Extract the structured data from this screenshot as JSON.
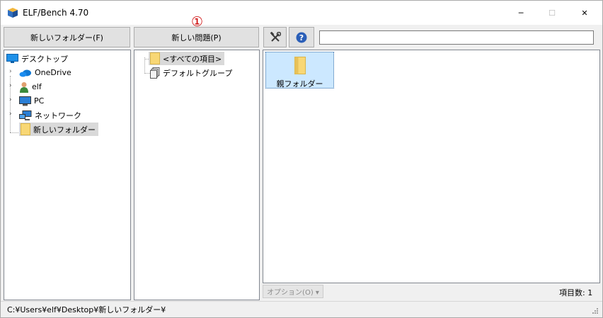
{
  "window": {
    "title": "ELF/Bench 4.70",
    "minimize_glyph": "─",
    "maximize_glyph": "☐",
    "close_glyph": "✕"
  },
  "toolbar": {
    "new_folder_label": "新しいフォルダー(F)",
    "new_problem_label": "新しい問題(P)",
    "tools_icon": "tools-icon",
    "help_icon": "help-icon",
    "search_value": "",
    "search_placeholder": ""
  },
  "annotation": {
    "marker": "①"
  },
  "folder_tree": {
    "items": [
      {
        "label": "デスクトップ",
        "icon": "desktop-icon"
      },
      {
        "label": "OneDrive",
        "icon": "cloud-icon"
      },
      {
        "label": "elf",
        "icon": "user-icon"
      },
      {
        "label": "PC",
        "icon": "computer-icon"
      },
      {
        "label": "ネットワーク",
        "icon": "network-icon"
      },
      {
        "label": "新しいフォルダー",
        "icon": "folder-icon",
        "selected": true
      }
    ]
  },
  "problem_tree": {
    "items": [
      {
        "label": "<すべての項目>",
        "icon": "folder-icon",
        "selected": true
      },
      {
        "label": "デフォルトグループ",
        "icon": "documents-icon"
      }
    ]
  },
  "item_view": {
    "items": [
      {
        "label": "親フォルダー",
        "icon": "folder-icon",
        "selected": true
      }
    ]
  },
  "footer": {
    "options_label": "オプション(O) ▾",
    "item_count": "項目数: 1"
  },
  "status_bar": {
    "path": "C:¥Users¥elf¥Desktop¥新しいフォルダー¥"
  },
  "colors": {
    "selection_bg": "#cce8ff",
    "tree_selection_bg": "#d9d9d9",
    "annotation": "#cc0000",
    "folder_yellow": "#f8d775"
  }
}
